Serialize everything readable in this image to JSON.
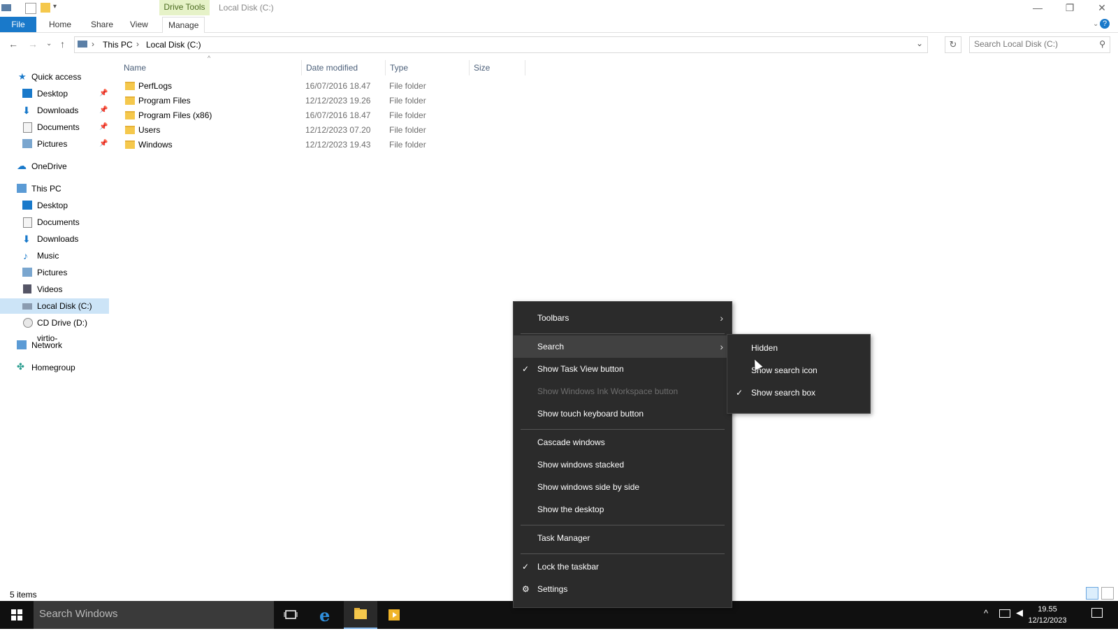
{
  "window": {
    "contextual_tab": "Drive Tools",
    "title": "Local Disk (C:)",
    "controls": [
      "—",
      "❐",
      "✕"
    ]
  },
  "ribbon": {
    "tabs": [
      "File",
      "Home",
      "Share",
      "View",
      "Manage"
    ],
    "help": "?"
  },
  "address": {
    "crumbs": [
      "This PC",
      "Local Disk (C:)"
    ],
    "search_placeholder": "Search Local Disk (C:)"
  },
  "nav": {
    "quick_access": "Quick access",
    "qa_items": [
      "Desktop",
      "Downloads",
      "Documents",
      "Pictures"
    ],
    "onedrive": "OneDrive",
    "this_pc": "This PC",
    "pc_items": [
      "Desktop",
      "Documents",
      "Downloads",
      "Music",
      "Pictures",
      "Videos",
      "Local Disk (C:)",
      "CD Drive (D:) virtio-"
    ],
    "network": "Network",
    "homegroup": "Homegroup"
  },
  "columns": {
    "name": "Name",
    "date": "Date modified",
    "type": "Type",
    "size": "Size"
  },
  "files": [
    {
      "name": "PerfLogs",
      "date": "16/07/2016 18.47",
      "type": "File folder"
    },
    {
      "name": "Program Files",
      "date": "12/12/2023 19.26",
      "type": "File folder"
    },
    {
      "name": "Program Files (x86)",
      "date": "16/07/2016 18.47",
      "type": "File folder"
    },
    {
      "name": "Users",
      "date": "12/12/2023 07.20",
      "type": "File folder"
    },
    {
      "name": "Windows",
      "date": "12/12/2023 19.43",
      "type": "File folder"
    }
  ],
  "status": {
    "count": "5 items"
  },
  "taskbar": {
    "search_placeholder": "Search Windows",
    "time": "19.55",
    "date": "12/12/2023"
  },
  "context_menu": {
    "toolbars": "Toolbars",
    "search": "Search",
    "task_view": "Show Task View button",
    "ink": "Show Windows Ink Workspace button",
    "touch_keyboard": "Show touch keyboard button",
    "cascade": "Cascade windows",
    "stacked": "Show windows stacked",
    "side_by_side": "Show windows side by side",
    "desktop": "Show the desktop",
    "task_manager": "Task Manager",
    "lock": "Lock the taskbar",
    "settings": "Settings"
  },
  "search_submenu": {
    "hidden": "Hidden",
    "icon": "Show search icon",
    "box": "Show search box"
  },
  "colors": {
    "accent": "#1979ca",
    "menu_bg": "#2b2b2b",
    "taskbar": "#101010"
  }
}
